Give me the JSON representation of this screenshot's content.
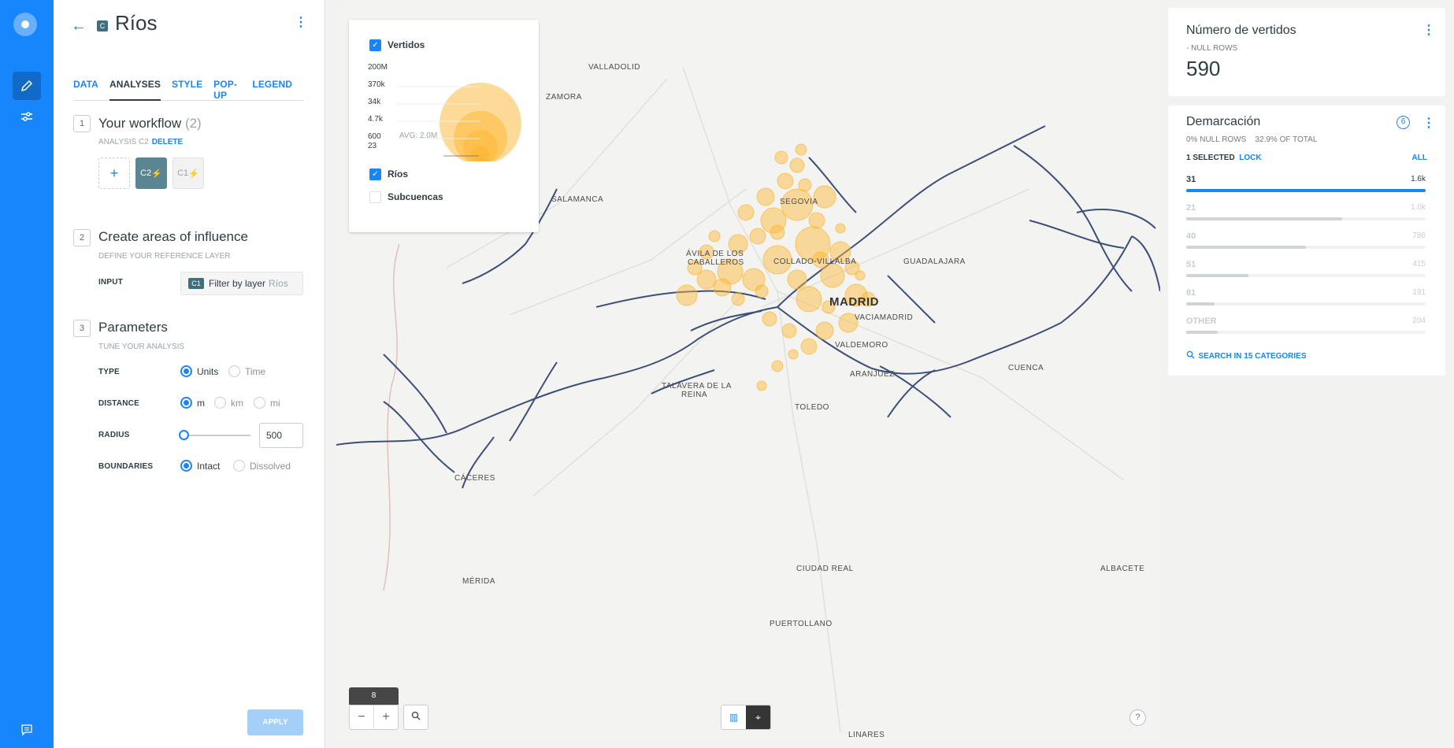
{
  "rail": {
    "items": [
      "edit-icon",
      "settings-icon",
      "feedback-icon"
    ]
  },
  "editor": {
    "layer_letter": "C",
    "title": "Ríos",
    "tabs": [
      "DATA",
      "ANALYSES",
      "STYLE",
      "POP-UP",
      "LEGEND"
    ],
    "active_tab": "ANALYSES",
    "step1": {
      "num": "1",
      "title": "Your workflow",
      "count": "(2)",
      "sub": "ANALYSIS C2",
      "delete": "DELETE",
      "nodes": {
        "add": "+",
        "c2": "C2",
        "c1": "C1"
      }
    },
    "step2": {
      "num": "2",
      "title": "Create areas of influence",
      "sub": "DEFINE YOUR REFERENCE LAYER",
      "input_label": "INPUT",
      "input_badge": "C1",
      "input_text": "Filter by layer",
      "input_layer": "Ríos"
    },
    "step3": {
      "num": "3",
      "title": "Parameters",
      "sub": "TUNE YOUR ANALYSIS",
      "type_label": "TYPE",
      "type_opts": [
        "Units",
        "Time"
      ],
      "distance_label": "DISTANCE",
      "distance_opts": [
        "m",
        "km",
        "mi"
      ],
      "radius_label": "RADIUS",
      "radius_value": "500",
      "boundaries_label": "BOUNDARIES",
      "boundaries_opts": [
        "Intact",
        "Dissolved"
      ]
    },
    "apply": "APPLY"
  },
  "legend": {
    "layer1": "Vertidos",
    "ticks": [
      "200M",
      "370k",
      "34k",
      "4.7k",
      "600",
      "23"
    ],
    "avg": "AVG: 2.0M",
    "layer2": "Ríos",
    "layer3": "Subcuencas",
    "bubble_color": "#fdb631"
  },
  "map": {
    "zoom": "8",
    "cities": [
      {
        "name": "VALLADOLID"
      },
      {
        "name": "ZAMORA"
      },
      {
        "name": "SALAMANCA"
      },
      {
        "name": "SEGOVIA"
      },
      {
        "name": "ÁVILA DE LOS"
      },
      {
        "name": "CABALLEROS"
      },
      {
        "name": "COLLADO-VILLALBA"
      },
      {
        "name": "GUADALAJARA"
      },
      {
        "name": "MADRID"
      },
      {
        "name": "VACIAMADRID"
      },
      {
        "name": "VALDEMORO"
      },
      {
        "name": "ARANJUEZ"
      },
      {
        "name": "TALAVERA DE LA"
      },
      {
        "name": "REINA"
      },
      {
        "name": "TOLEDO"
      },
      {
        "name": "CUENCA"
      },
      {
        "name": "CÁCERES"
      },
      {
        "name": "MÉRIDA"
      },
      {
        "name": "CIUDAD REAL"
      },
      {
        "name": "ALBACETE"
      },
      {
        "name": "PUERTOLLANO"
      },
      {
        "name": "LINARES"
      }
    ],
    "river_color": "#3d4e78"
  },
  "widgets": {
    "w1": {
      "title": "Número de vertidos",
      "sub": "- NULL ROWS",
      "value": "590"
    },
    "w2": {
      "title": "Demarcación",
      "null_rows": "0% NULL ROWS",
      "of_total": "32.9% OF TOTAL",
      "selected": "1 SELECTED",
      "lock": "LOCK",
      "all": "ALL",
      "filter_icon": "6",
      "rows": [
        {
          "name": "31",
          "value": "1.6k",
          "pct": 1.0,
          "selected": true
        },
        {
          "name": "21",
          "value": "1.0k",
          "pct": 0.65,
          "selected": false
        },
        {
          "name": "40",
          "value": "786",
          "pct": 0.5,
          "selected": false
        },
        {
          "name": "51",
          "value": "415",
          "pct": 0.26,
          "selected": false
        },
        {
          "name": "81",
          "value": "191",
          "pct": 0.12,
          "selected": false
        },
        {
          "name": "OTHER",
          "value": "204",
          "pct": 0.13,
          "selected": false
        }
      ],
      "search": "SEARCH IN 15 CATEGORIES"
    }
  }
}
